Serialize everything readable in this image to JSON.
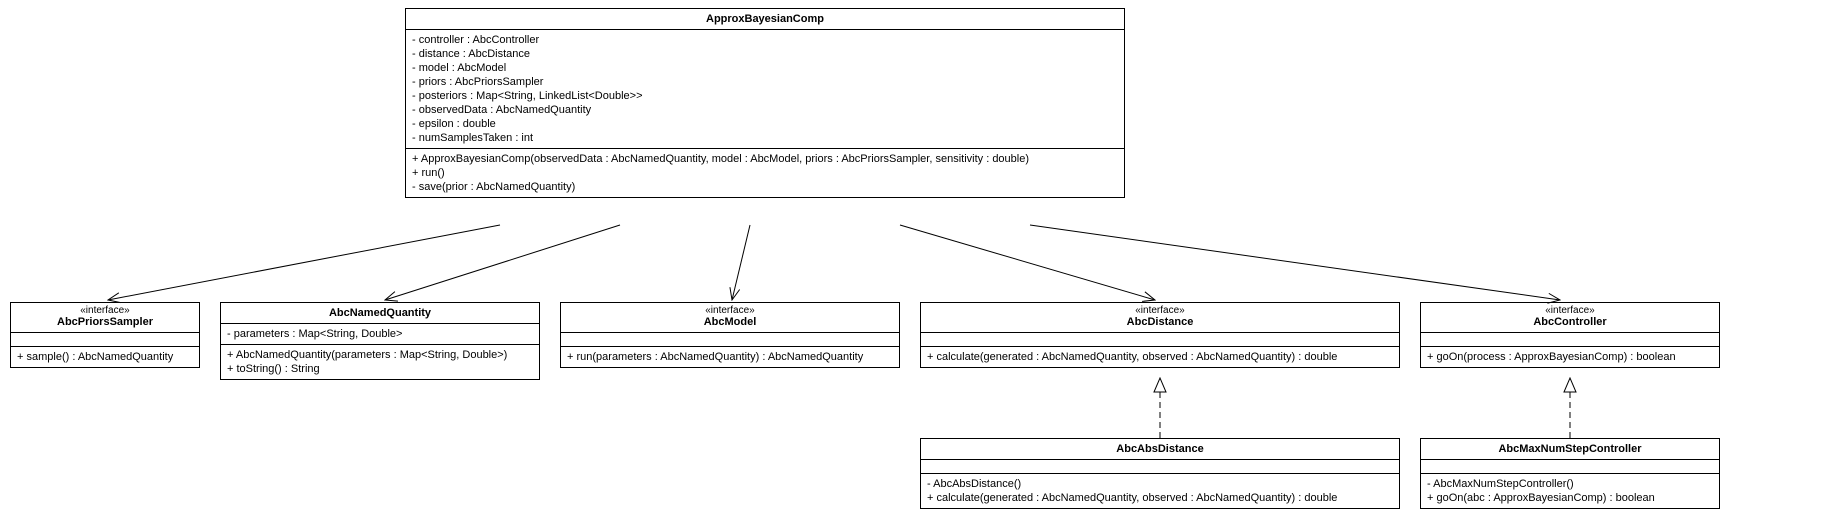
{
  "classes": {
    "ApproxBayesianComp": {
      "name": "ApproxBayesianComp",
      "attributes": [
        "- controller : AbcController",
        "- distance : AbcDistance",
        "- model : AbcModel",
        "- priors : AbcPriorsSampler",
        "- posteriors : Map<String, LinkedList<Double>>",
        "- observedData : AbcNamedQuantity",
        "- epsilon : double",
        "- numSamplesTaken : int"
      ],
      "operations": [
        "+ ApproxBayesianComp(observedData : AbcNamedQuantity, model : AbcModel, priors : AbcPriorsSampler, sensitivity : double)",
        "+ run()",
        "- save(prior : AbcNamedQuantity)"
      ]
    },
    "AbcPriorsSampler": {
      "stereotype": "«interface»",
      "name": "AbcPriorsSampler",
      "attributes": [],
      "operations": [
        "+ sample() : AbcNamedQuantity"
      ]
    },
    "AbcNamedQuantity": {
      "name": "AbcNamedQuantity",
      "attributes": [
        "- parameters : Map<String, Double>"
      ],
      "operations": [
        "+ AbcNamedQuantity(parameters : Map<String, Double>)",
        "+ toString() : String"
      ]
    },
    "AbcModel": {
      "stereotype": "«interface»",
      "name": "AbcModel",
      "attributes": [],
      "operations": [
        "+ run(parameters : AbcNamedQuantity) : AbcNamedQuantity"
      ]
    },
    "AbcDistance": {
      "stereotype": "«interface»",
      "name": "AbcDistance",
      "attributes": [],
      "operations": [
        "+ calculate(generated : AbcNamedQuantity, observed : AbcNamedQuantity) : double"
      ]
    },
    "AbcController": {
      "stereotype": "«interface»",
      "name": "AbcController",
      "attributes": [],
      "operations": [
        "+ goOn(process : ApproxBayesianComp) : boolean"
      ]
    },
    "AbcAbsDistance": {
      "name": "AbcAbsDistance",
      "attributes": [],
      "operations": [
        "- AbcAbsDistance()",
        "+ calculate(generated : AbcNamedQuantity, observed : AbcNamedQuantity) : double"
      ]
    },
    "AbcMaxNumStepController": {
      "name": "AbcMaxNumStepController",
      "attributes": [],
      "operations": [
        "- AbcMaxNumStepController()",
        "+ goOn(abc : ApproxBayesianComp) : boolean"
      ]
    }
  },
  "chart_data": {
    "type": "uml-class-diagram",
    "nodes": [
      "ApproxBayesianComp",
      "AbcPriorsSampler",
      "AbcNamedQuantity",
      "AbcModel",
      "AbcDistance",
      "AbcController",
      "AbcAbsDistance",
      "AbcMaxNumStepController"
    ],
    "edges": [
      {
        "from": "ApproxBayesianComp",
        "to": "AbcPriorsSampler",
        "type": "association-directed"
      },
      {
        "from": "ApproxBayesianComp",
        "to": "AbcNamedQuantity",
        "type": "association-directed"
      },
      {
        "from": "ApproxBayesianComp",
        "to": "AbcModel",
        "type": "association-directed"
      },
      {
        "from": "ApproxBayesianComp",
        "to": "AbcDistance",
        "type": "association-directed"
      },
      {
        "from": "ApproxBayesianComp",
        "to": "AbcController",
        "type": "association-directed"
      },
      {
        "from": "AbcAbsDistance",
        "to": "AbcDistance",
        "type": "realization"
      },
      {
        "from": "AbcMaxNumStepController",
        "to": "AbcController",
        "type": "realization"
      }
    ]
  }
}
